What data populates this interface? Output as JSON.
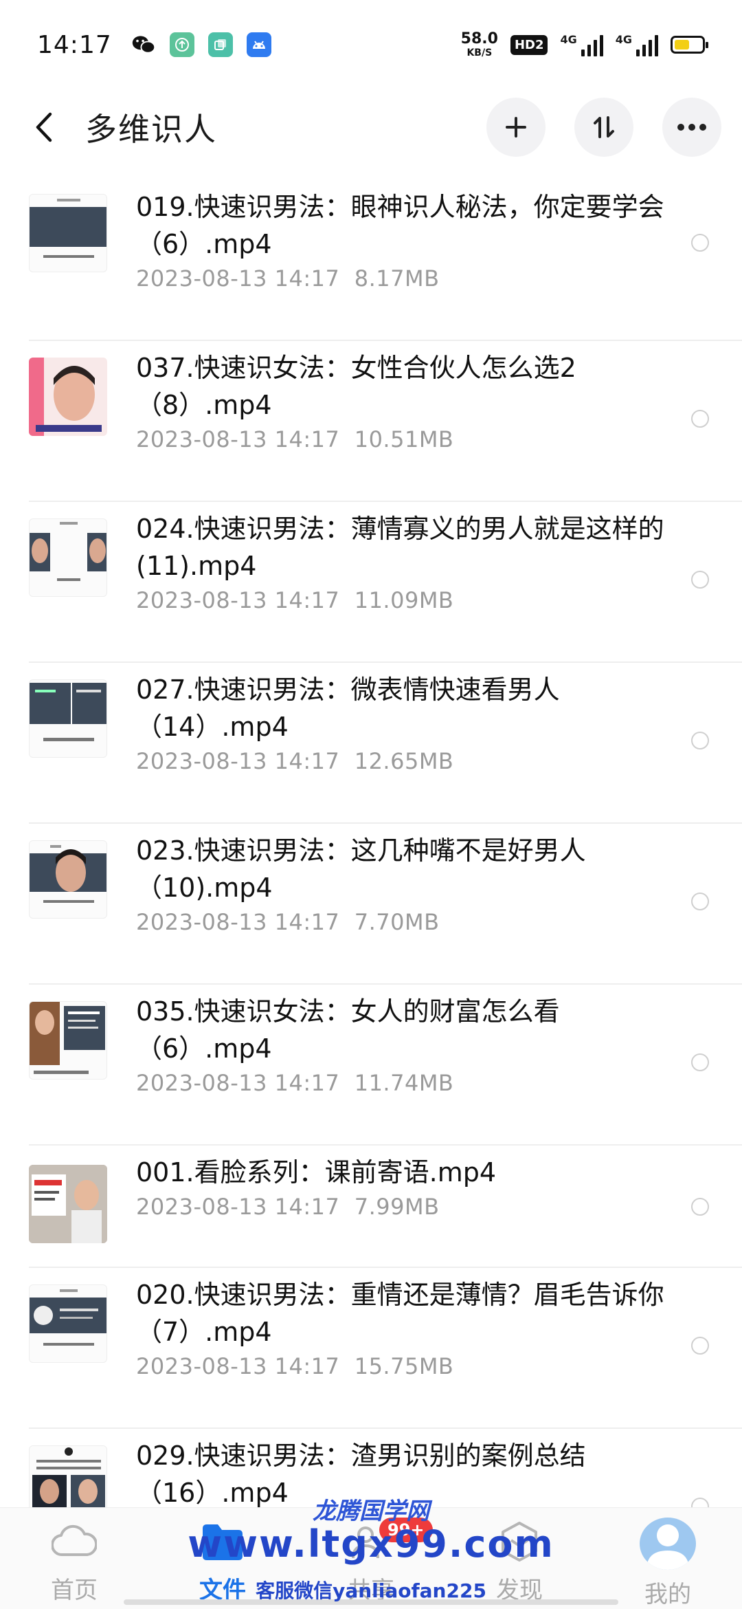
{
  "status_bar": {
    "time": "14:17",
    "speed_value": "58.0",
    "speed_unit": "KB/S",
    "hd_label": "HD2",
    "net1": "4G",
    "net2": "4G"
  },
  "header": {
    "title": "多维识人"
  },
  "files": [
    {
      "title": "019.快速识男法：眼神识人秘法，你定要学会（6）.mp4",
      "date": "2023-08-13  14:17",
      "size": "8.17MB"
    },
    {
      "title": "037.快速识女法：女性合伙人怎么选2（8）.mp4",
      "date": "2023-08-13  14:17",
      "size": "10.51MB"
    },
    {
      "title": "024.快速识男法：薄情寡义的男人就是这样的 (11).mp4",
      "date": "2023-08-13  14:17",
      "size": "11.09MB"
    },
    {
      "title": "027.快速识男法：微表情快速看男人（14）.mp4",
      "date": "2023-08-13  14:17",
      "size": "12.65MB"
    },
    {
      "title": "023.快速识男法：这几种嘴不是好男人（10).mp4",
      "date": "2023-08-13  14:17",
      "size": "7.70MB"
    },
    {
      "title": "035.快速识女法：女人的财富怎么看（6）.mp4",
      "date": "2023-08-13  14:17",
      "size": "11.74MB"
    },
    {
      "title": "001.看脸系列：课前寄语.mp4",
      "date": "2023-08-13  14:17",
      "size": "7.99MB"
    },
    {
      "title": "020.快速识男法：重情还是薄情？眉毛告诉你（7）.mp4",
      "date": "2023-08-13  14:17",
      "size": "15.75MB"
    },
    {
      "title": "029.快速识男法：渣男识别的案例总结（16）.mp4",
      "date": "",
      "size": ""
    }
  ],
  "bottom_nav": {
    "home": "首页",
    "files": "文件",
    "share": "共享",
    "discover": "发现",
    "mine": "我的",
    "badge": "99+"
  },
  "watermark": {
    "line1": "龙腾国学网",
    "line2": "www.ltgx99.com",
    "line3": "客服微信yanliaofan225"
  }
}
